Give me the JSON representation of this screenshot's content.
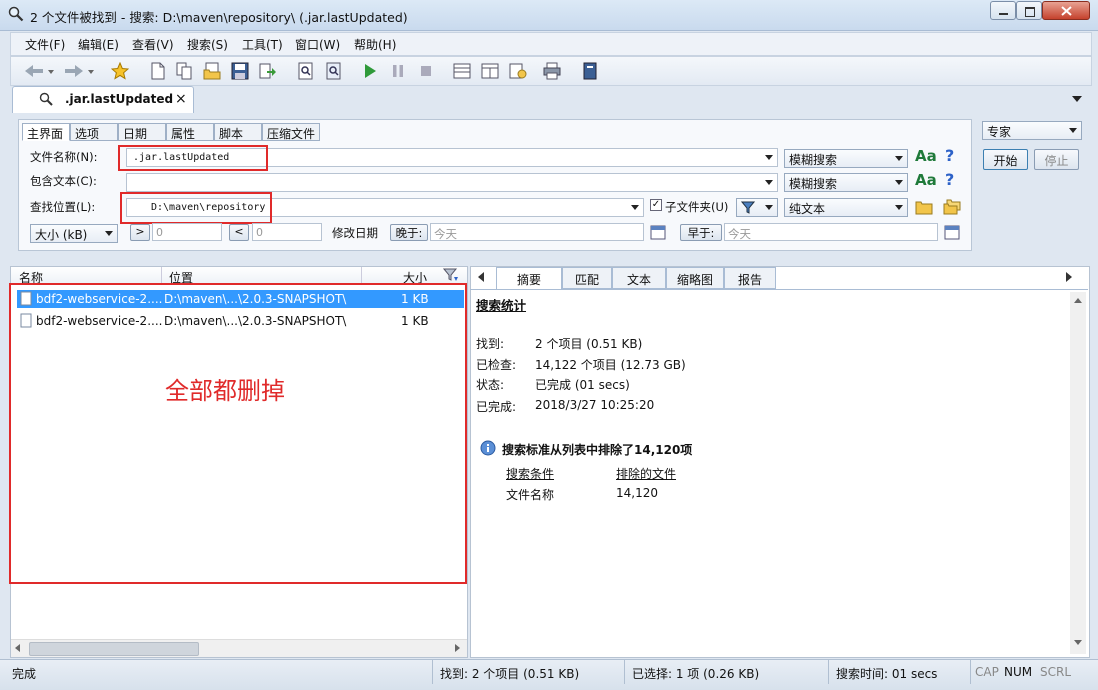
{
  "window": {
    "title": "2 个文件被找到 - 搜索: D:\\maven\\repository\\ (.jar.lastUpdated)"
  },
  "menu": [
    "文件(F)",
    "编辑(E)",
    "查看(V)",
    "搜索(S)",
    "工具(T)",
    "窗口(W)",
    "帮助(H)"
  ],
  "doc_tab": {
    "label": ".jar.lastUpdated",
    "close": "×"
  },
  "search_tabs": [
    "主界面",
    "选项",
    "日期",
    "属性",
    "脚本",
    "压缩文件"
  ],
  "form": {
    "filename_label": "文件名称(N):",
    "filename_value": ".jar.lastUpdated",
    "contains_label": "包含文本(C):",
    "contains_value": "",
    "location_label": "查找位置(L):",
    "location_value": "D:\\maven\\repository",
    "subfolder_label": "子文件夹(U)",
    "mode1": "模糊搜索",
    "mode2": "模糊搜索",
    "mode3": "纯文本",
    "aa": "Aa",
    "help": "?",
    "size_combo": "大小 (kB)",
    "gt": ">",
    "lt": "<",
    "size_min": "0",
    "size_max": "0",
    "modified_label": "修改日期",
    "after_label": "晚于:",
    "after_value": "今天",
    "before_label": "早于:",
    "before_value": "今天"
  },
  "side": {
    "profile": "专家",
    "start": "开始",
    "stop": "停止"
  },
  "results": {
    "columns": [
      "名称",
      "位置",
      "大小"
    ],
    "rows": [
      {
        "name": "bdf2-webservice-2....",
        "location": "D:\\maven\\...\\2.0.3-SNAPSHOT\\",
        "size": "1 KB"
      },
      {
        "name": "bdf2-webservice-2....",
        "location": "D:\\maven\\...\\2.0.3-SNAPSHOT\\",
        "size": "1 KB"
      }
    ],
    "annotation": "全部都删掉"
  },
  "detail_tabs": [
    "摘要",
    "匹配",
    "文本",
    "缩略图",
    "报告"
  ],
  "summary": {
    "heading": "搜索统计",
    "stats": [
      {
        "label": "找到:",
        "value": "2 个项目 (0.51 KB)"
      },
      {
        "label": "已检查:",
        "value": "14,122 个项目 (12.73 GB)"
      },
      {
        "label": "状态:",
        "value": "已完成 (01 secs)"
      },
      {
        "label": "已完成:",
        "value": "2018/3/27 10:25:20"
      }
    ],
    "info_heading": "搜索标准从列表中排除了14,120项",
    "excl_col1": "搜索条件",
    "excl_col2": "排除的文件",
    "excl_row_label": "文件名称",
    "excl_row_value": "14,120"
  },
  "status": {
    "state": "完成",
    "found": "找到: 2 个项目 (0.51 KB)",
    "selected": "已选择: 1 项 (0.26 KB)",
    "time": "搜索时间: 01 secs",
    "cap": "CAP",
    "num": "NUM",
    "scrl": "SCRL"
  },
  "colors": {
    "annotation_red": "#e02a2a",
    "selection": "#3399ff",
    "window_bg": "#dfe7f1"
  }
}
